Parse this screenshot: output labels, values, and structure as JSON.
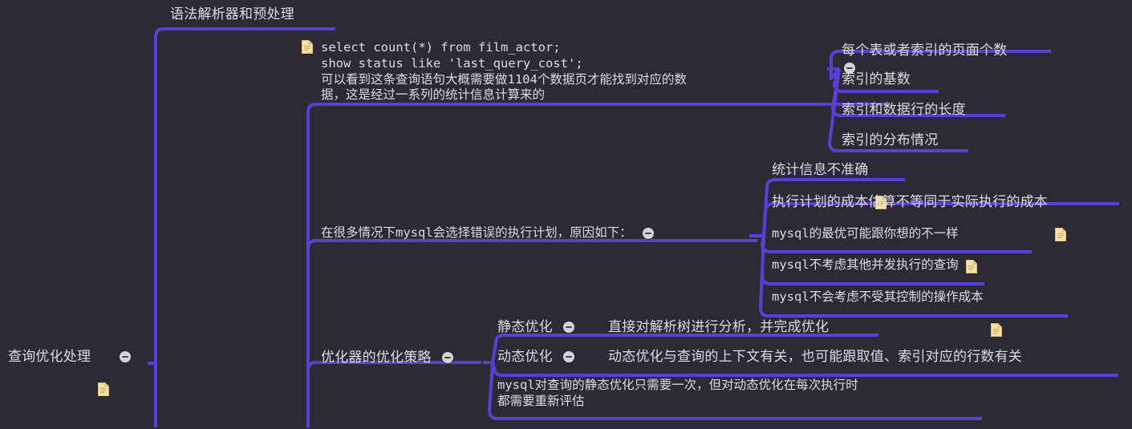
{
  "theme": {
    "background": "#2e2a35",
    "link_color": "#5b3fd4",
    "text_color": "#dedae2",
    "note_icon_color": "#f6e3a8",
    "bullet_color": "#d5d2da"
  },
  "title": "查询优化处理",
  "icons": {
    "note": "note-icon",
    "collapse": "collapse-bullet"
  },
  "root": {
    "label": "查询优化处理",
    "has_note": true,
    "has_collapse": true
  },
  "branches": [
    {
      "id": "parser",
      "label": "语法解析器和预处理",
      "has_note": true,
      "has_collapse": false
    },
    {
      "id": "cost",
      "label": "select count(*) from film_actor;\nshow status like 'last_query_cost';\n可以看到这条查询语句大概需要做1104个数据页才能找到对应的数\n据，这是经过一系列的统计信息计算来的",
      "has_note": false,
      "has_collapse": true,
      "children": [
        {
          "label": "每个表或者索引的页面个数",
          "has_note": false
        },
        {
          "label": "索引的基数",
          "has_note": false
        },
        {
          "label": "索引和数据行的长度",
          "has_note": false
        },
        {
          "label": "索引的分布情况",
          "has_note": false
        }
      ]
    },
    {
      "id": "wrong-plan",
      "label": "在很多情况下mysql会选择错误的执行计划，原因如下：",
      "has_note": false,
      "has_collapse": true,
      "children": [
        {
          "label": "统计信息不准确",
          "has_note": true
        },
        {
          "label": "执行计划的成本估算不等同于实际执行的成本",
          "has_note": true
        },
        {
          "label": "mysql的最优可能跟你想的不一样",
          "has_note": true,
          "mono": true
        },
        {
          "label": "mysql不考虑其他并发执行的查询",
          "has_note": false,
          "mono": true
        },
        {
          "label": "mysql不会考虑不受其控制的操作成本",
          "has_note": true,
          "mono": true
        }
      ]
    },
    {
      "id": "optimizer-strategy",
      "label": "优化器的优化策略",
      "has_note": false,
      "has_collapse": true,
      "children": [
        {
          "label": "静态优化",
          "has_collapse": true,
          "detail": "直接对解析树进行分析，并完成优化"
        },
        {
          "label": "动态优化",
          "has_collapse": true,
          "detail": "动态优化与查询的上下文有关，也可能跟取值、索引对应的行数有关"
        },
        {
          "label": "mysql对查询的静态优化只需要一次，但对动态优化在每次执行时\n都需要重新评估",
          "mono": true,
          "has_collapse": false
        }
      ]
    }
  ]
}
